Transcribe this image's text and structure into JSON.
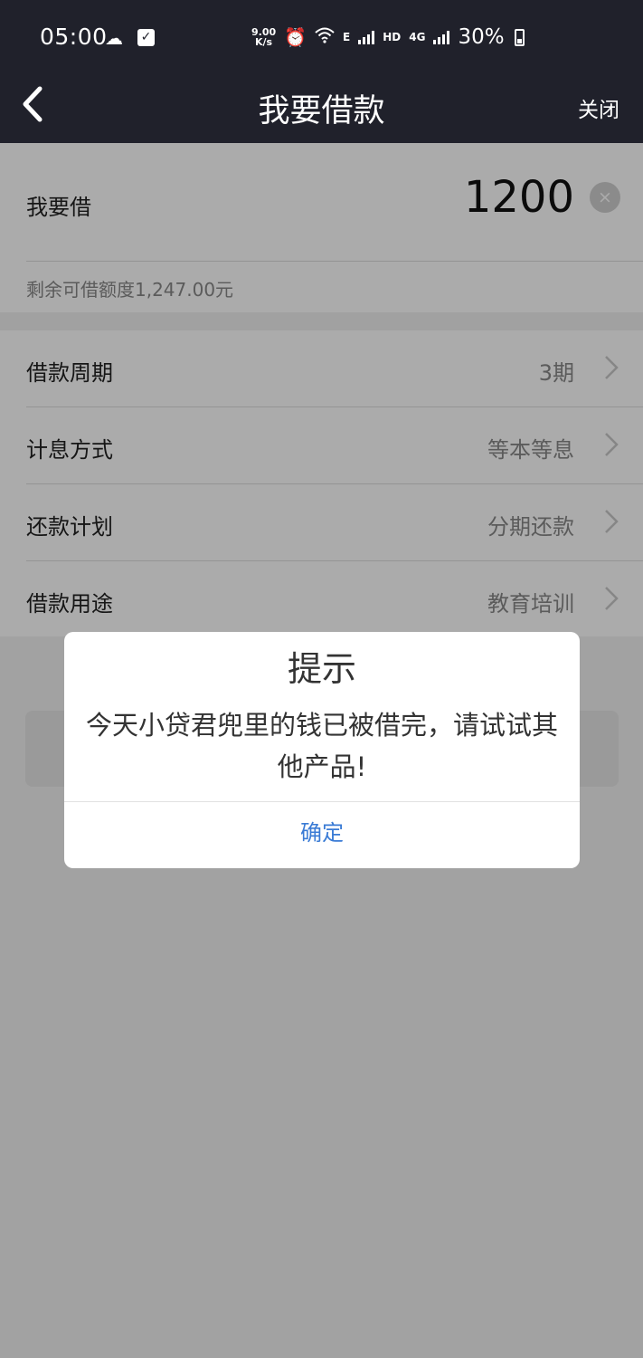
{
  "status_bar": {
    "time": "05:00",
    "net_speed_value": "9.00",
    "net_speed_unit": "K/s",
    "network_e": "E",
    "network_hd": "HD",
    "network_4g": "4G",
    "battery": "30%"
  },
  "header": {
    "title": "我要借款",
    "close_label": "关闭"
  },
  "loan": {
    "label": "我要借",
    "amount": "1200",
    "clear_glyph": "×",
    "remaining": "剩余可借额度1,247.00元"
  },
  "options": [
    {
      "label": "借款周期",
      "value": "3期"
    },
    {
      "label": "计息方式",
      "value": "等本等息"
    },
    {
      "label": "还款计划",
      "value": "分期还款"
    },
    {
      "label": "借款用途",
      "value": "教育培训"
    }
  ],
  "dialog": {
    "title": "提示",
    "message": "今天小贷君兜里的钱已被借完，请试试其他产品!",
    "confirm_label": "确定"
  },
  "colors": {
    "header_bg": "#20212b",
    "confirm_text": "#3a7bd5",
    "overlay": "rgba(0,0,0,0.33)"
  }
}
